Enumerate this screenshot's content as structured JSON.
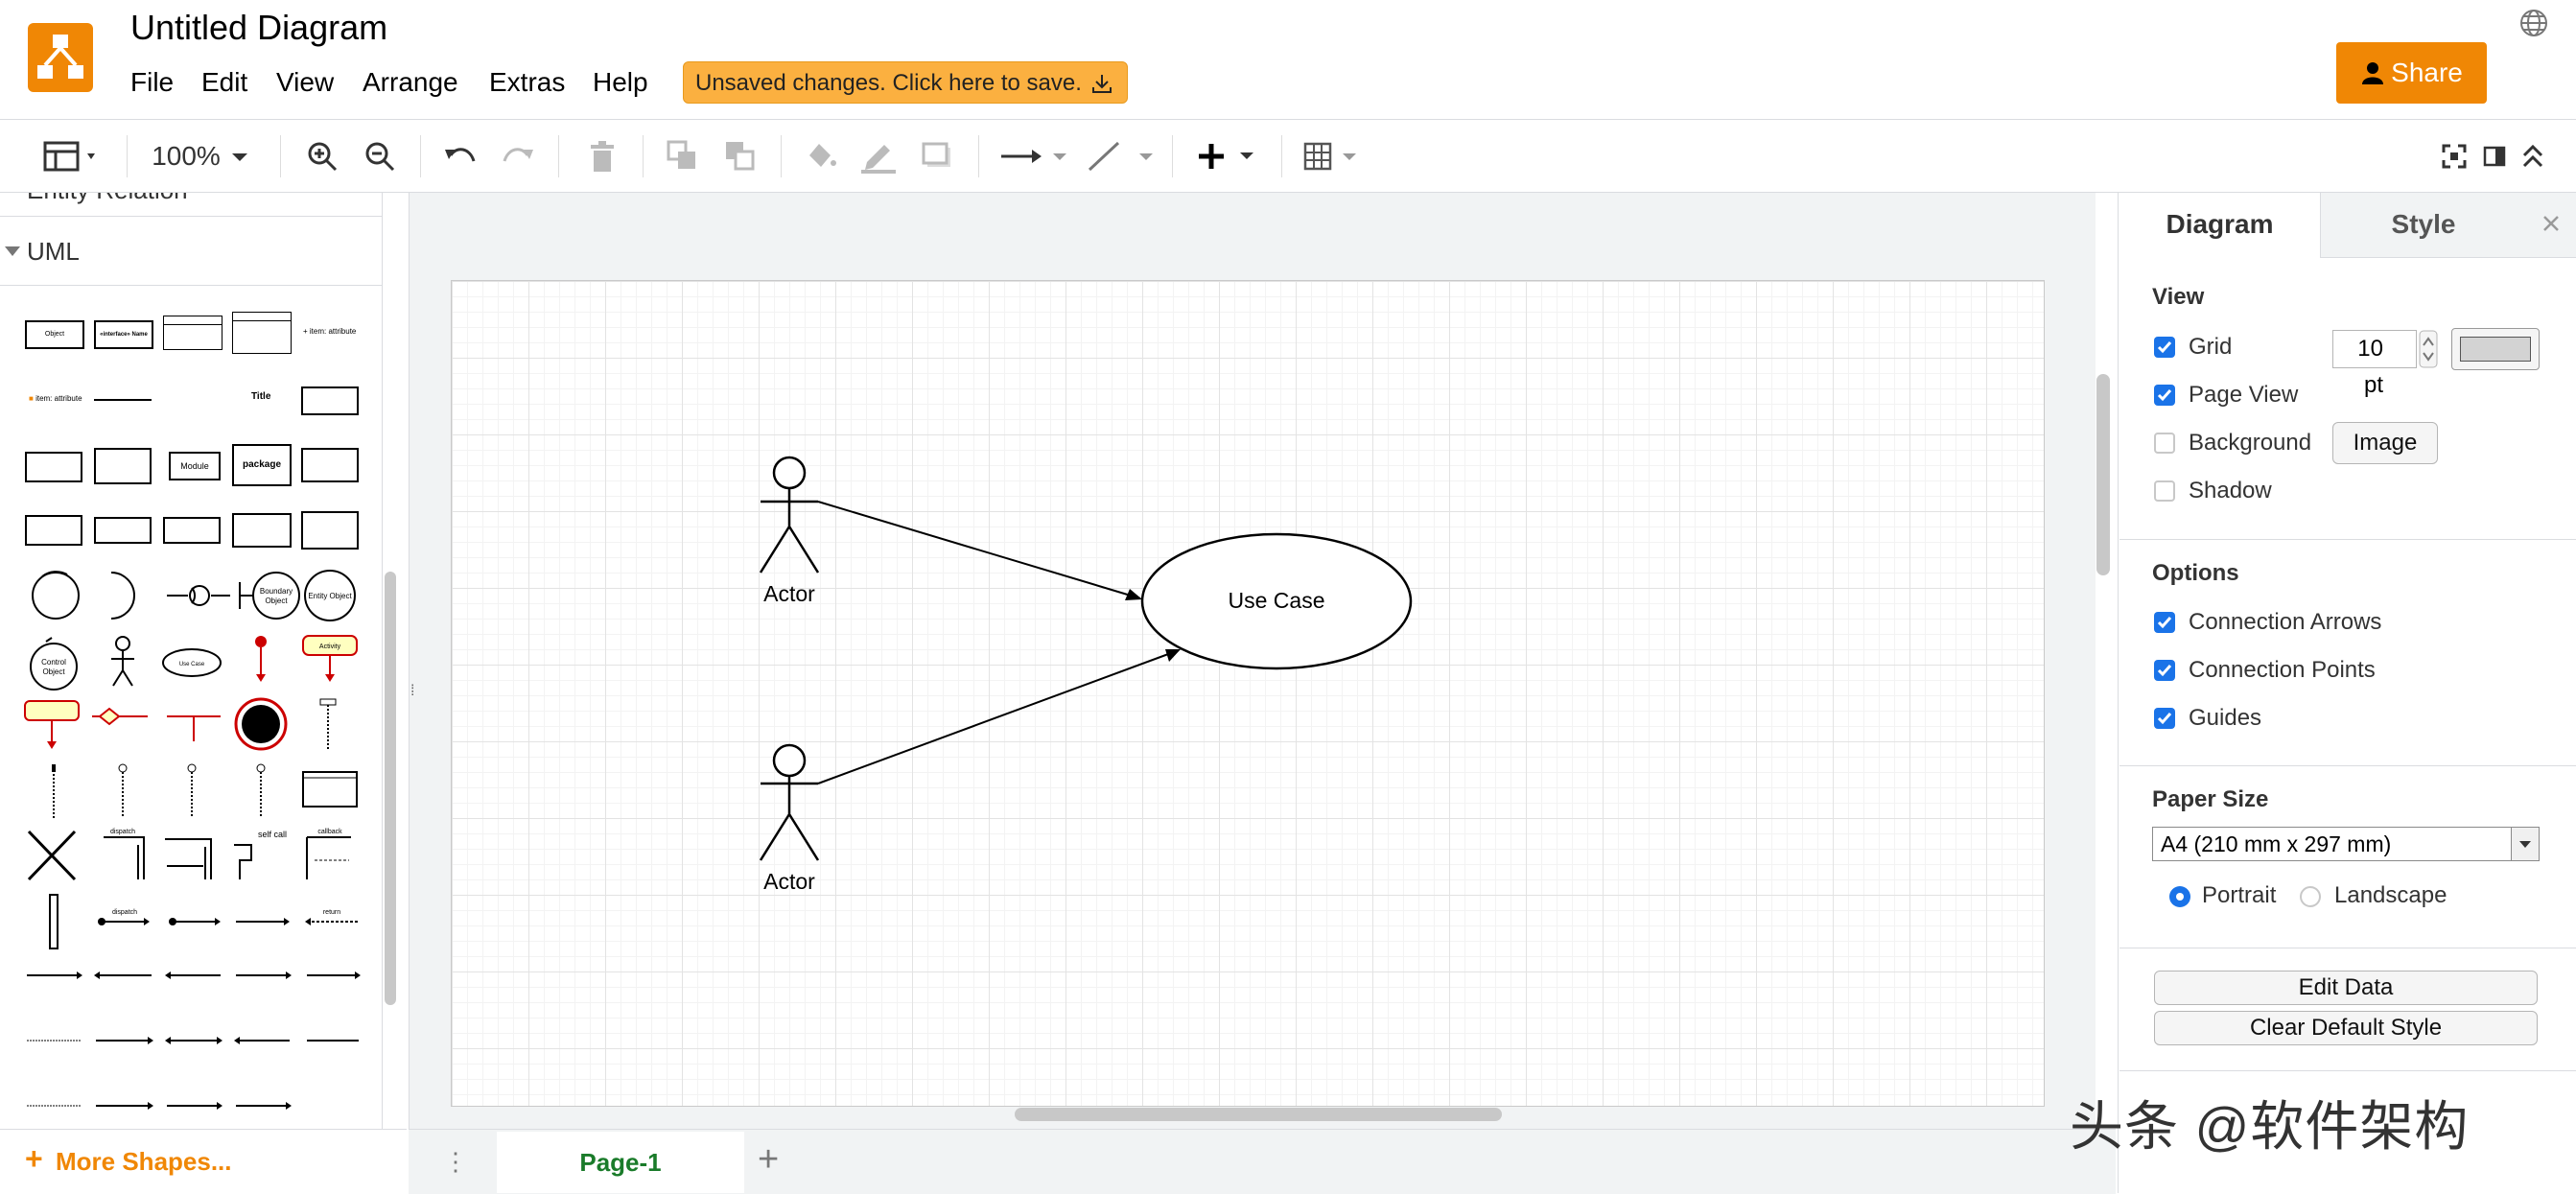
{
  "app": {
    "title": "Untitled Diagram",
    "menus": [
      "File",
      "Edit",
      "View",
      "Arrange",
      "Extras",
      "Help"
    ],
    "unsaved_notice": "Unsaved changes. Click here to save.",
    "share_label": "Share"
  },
  "toolbar": {
    "zoom": "100%"
  },
  "sidebar": {
    "prev_section": "Entity Relation",
    "section": "UML",
    "more_shapes": "More Shapes...",
    "thumbnail_labels": [
      "Object",
      "«interface» Name",
      "+ item: attribute",
      "Title",
      "Module",
      "package",
      "Boundary Object",
      "Entity Object",
      "Control Object",
      "Use Case",
      "Activity",
      "dispatch",
      "self call",
      "callback",
      "return"
    ]
  },
  "canvas": {
    "actor1_label": "Actor",
    "actor2_label": "Actor",
    "usecase_label": "Use Case"
  },
  "pages": {
    "current": "Page-1",
    "add_label": "+"
  },
  "format_panel": {
    "tabs": [
      "Diagram",
      "Style"
    ],
    "view": {
      "heading": "View",
      "grid_label": "Grid",
      "grid_size": "10 pt",
      "page_view_label": "Page View",
      "background_label": "Background",
      "image_button": "Image",
      "shadow_label": "Shadow"
    },
    "options": {
      "heading": "Options",
      "connection_arrows": "Connection Arrows",
      "connection_points": "Connection Points",
      "guides": "Guides"
    },
    "paper": {
      "heading": "Paper Size",
      "selected": "A4 (210 mm x 297 mm)",
      "portrait": "Portrait",
      "landscape": "Landscape"
    },
    "edit_data": "Edit Data",
    "clear_default_style": "Clear Default Style"
  },
  "watermark": "头条 @软件架构",
  "colors": {
    "accent_orange": "#f08705",
    "notice_bg": "#fbb040",
    "checkbox_blue": "#1a73e8",
    "page_tab_green": "#1a7b2a"
  }
}
